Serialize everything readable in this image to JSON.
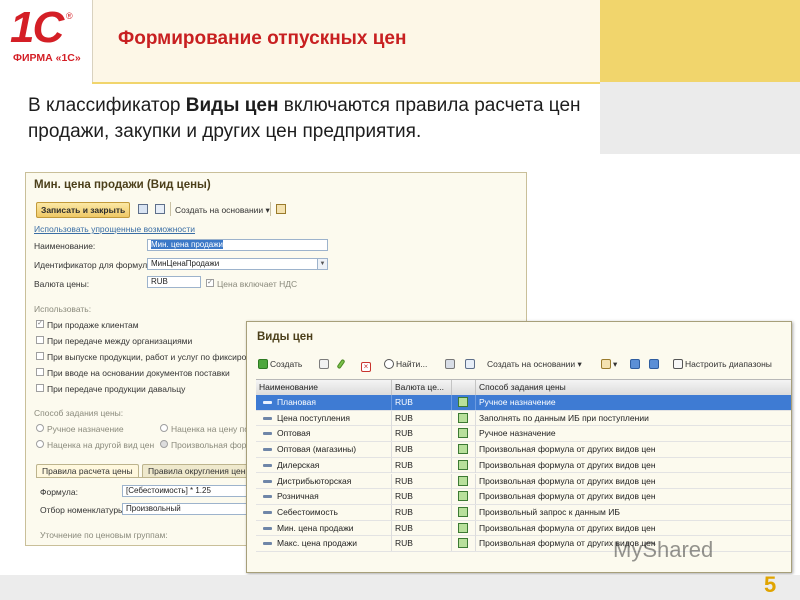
{
  "logo": {
    "brand": "1С",
    "company": "ФИРМА «1С»",
    "registered_mark": "®"
  },
  "slide": {
    "title": "Формирование отпускных цен",
    "intro_prefix": "В классификатор ",
    "intro_bold": "Виды цен",
    "intro_suffix": " включаются правила расчета цен продажи, закупки и других цен предприятия.",
    "page_number": "5"
  },
  "form": {
    "title": "Мин. цена продажи (Вид цены)",
    "toolbar": {
      "save_close": "Записать и закрыть",
      "create_based": "Создать на основании ▾"
    },
    "simplified_link": "Использовать упрощенные возможности",
    "name_label": "Наименование:",
    "name_value": "Мин. цена продажи",
    "id_label": "Идентификатор для формул:",
    "id_value": "МинЦенаПродажи",
    "currency_label": "Валюта цены:",
    "currency_value": "RUB",
    "vat_label": "Цена включает НДС",
    "use_label": "Использовать:",
    "use_options": [
      "При продаже клиентам",
      "При передаче между организациями",
      "При выпуске продукции, работ и услуг по фиксирова",
      "При вводе на основании документов поставки",
      "При передаче продукции давальцу"
    ],
    "method_label": "Способ задания цены:",
    "method_options": [
      "Ручное назначение",
      "Наценка на цену пос",
      "Наценка на другой вид цен",
      "Произвольная форм"
    ],
    "tabs": [
      "Правила расчета цены",
      "Правила округления цены"
    ],
    "formula_label": "Формула:",
    "formula_value": "[Себестоимость] * 1.25",
    "nomenclature_label": "Отбор номенклатуры:",
    "nomenclature_value": "Произвольный",
    "refine_label": "Уточнение по ценовым группам:"
  },
  "list": {
    "title": "Виды цен",
    "toolbar": {
      "create": "Создать",
      "find": "Найти...",
      "create_based": "Создать на основании ▾",
      "configure_ranges": "Настроить диапазоны"
    },
    "columns": [
      "Наименование",
      "Валюта це...",
      "",
      "Способ задания цены"
    ],
    "rows": [
      {
        "name": "Плановая",
        "currency": "RUB",
        "method": "Ручное назначение",
        "selected": true
      },
      {
        "name": "Цена поступления",
        "currency": "RUB",
        "method": "Заполнять по данным ИБ при поступлении"
      },
      {
        "name": "Оптовая",
        "currency": "RUB",
        "method": "Ручное назначение"
      },
      {
        "name": "Оптовая (магазины)",
        "currency": "RUB",
        "method": "Произвольная формула от других видов цен"
      },
      {
        "name": "Дилерская",
        "currency": "RUB",
        "method": "Произвольная формула от других видов цен"
      },
      {
        "name": "Дистрибьюторская",
        "currency": "RUB",
        "method": "Произвольная формула от других видов цен"
      },
      {
        "name": "Розничная",
        "currency": "RUB",
        "method": "Произвольная формула от других видов цен"
      },
      {
        "name": "Себестоимость",
        "currency": "RUB",
        "method": "Произвольный запрос к данным ИБ"
      },
      {
        "name": "Мин. цена продажи",
        "currency": "RUB",
        "method": "Произвольная формула от других видов цен"
      },
      {
        "name": "Макс. цена продажи",
        "currency": "RUB",
        "method": "Произвольная формула от других видов цен"
      }
    ]
  },
  "watermark": "MyShared",
  "colors": {
    "brand_red": "#d41f26",
    "title_red": "#c82021",
    "gold": "#f1d56c",
    "selection_blue": "#3e7bd3"
  }
}
